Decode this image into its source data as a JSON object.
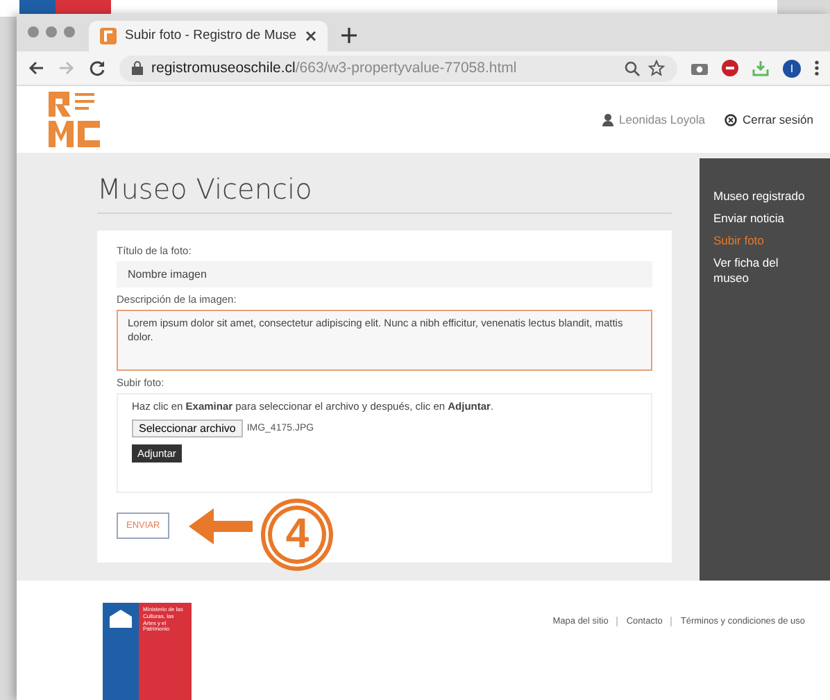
{
  "browser": {
    "tab_title": "Subir foto - Registro de Muse",
    "url_host": "registromuseoschile.cl",
    "url_path": "/663/w3-propertyvalue-77058.html",
    "profile_initial": "I"
  },
  "header": {
    "user": "Leonidas Loyola",
    "logout": "Cerrar sesión"
  },
  "page_title": "Museo Vicencio",
  "form": {
    "title_label": "Título de la foto:",
    "title_value": "Nombre imagen",
    "desc_label": "Descripción de la imagen:",
    "desc_value": "Lorem ipsum dolor sit amet, consectetur adipiscing elit. Nunc a nibh efficitur, venenatis lectus blandit, mattis dolor.",
    "upload_label": "Subir foto:",
    "upload_hint": "Haz clic en **Examinar** para seleccionar el archivo y después, clic en **Adjuntar**.",
    "file_button": "Seleccionar archivo",
    "file_name": "IMG_4175.JPG",
    "attach_button": "Adjuntar",
    "submit": "ENVIAR"
  },
  "annotation": {
    "step": "4"
  },
  "sidebar": {
    "items": [
      {
        "label": "Museo registrado",
        "selected": false
      },
      {
        "label": "Enviar noticia",
        "selected": false
      },
      {
        "label": "Subir foto",
        "selected": true
      },
      {
        "label": "Ver ficha del museo",
        "selected": false
      }
    ]
  },
  "footer": {
    "links": [
      "Mapa del sitio",
      "Contacto",
      "Términos y condiciones de uso"
    ],
    "ministry": "Ministerio de las Culturas, las Artes y el Patrimonio"
  }
}
